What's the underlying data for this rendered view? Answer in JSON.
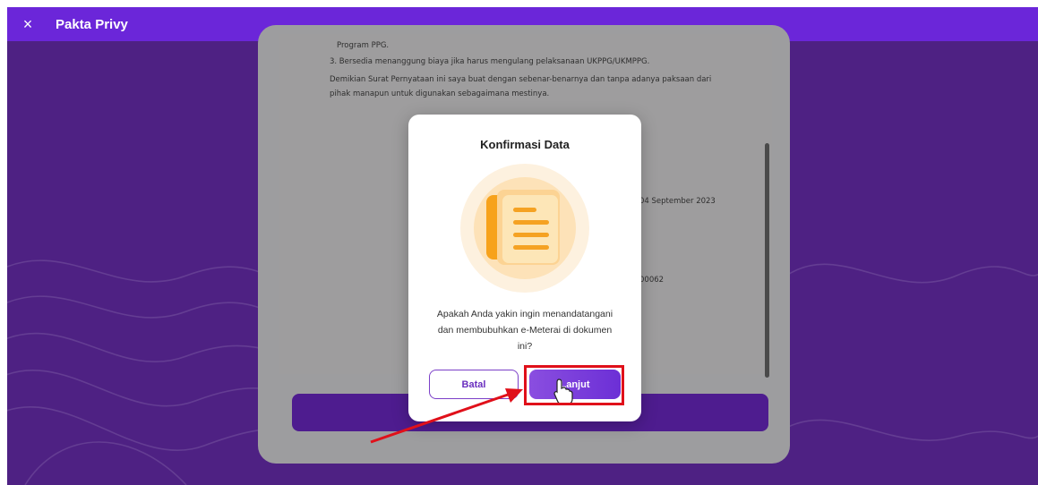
{
  "header": {
    "title": "Pakta Privy",
    "close_icon": "×"
  },
  "document": {
    "lines": [
      "Program PPG.",
      "3. Bersedia menanggung biaya jika harus mengulang pelaksanaan UKPPG/UKMPPG.",
      "Demikian Surat Pernyataan ini saya buat dengan sebenar-benarnya dan tanpa adanya paksaan dari",
      "pihak manapun untuk digunakan sebagaimana mestinya."
    ],
    "date_fragment": "04 September 2023",
    "number_fragment": "00062"
  },
  "modal": {
    "title": "Konfirmasi Data",
    "message_lines": [
      "Apakah Anda yakin ingin menandatangani",
      "dan membubuhkan e-Meterai di dokumen",
      "ini?"
    ],
    "cancel_label": "Batal",
    "next_label": "Lanjut"
  },
  "colors": {
    "header": "#6b26d9",
    "background": "#4e2183",
    "accent": "#7b3fc8",
    "highlight": "#e0101a"
  },
  "icons": [
    "close-icon",
    "document-icon",
    "cursor-hand-icon",
    "annotation-arrow"
  ]
}
